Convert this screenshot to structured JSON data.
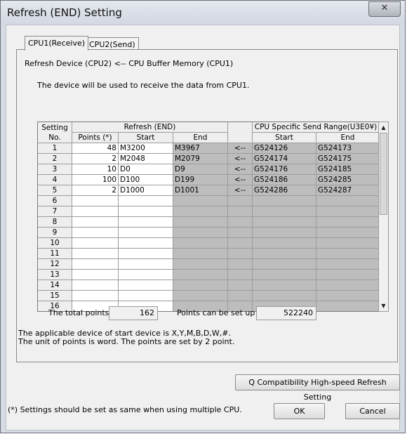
{
  "window": {
    "title": "Refresh (END) Setting",
    "close_glyph": "✕"
  },
  "tabs": [
    {
      "label": "CPU1(Receive)"
    },
    {
      "label": "CPU2(Send)"
    }
  ],
  "header": {
    "refresh_device": "Refresh Device (CPU2) <-- CPU Buffer Memory (CPU1)",
    "description": "The device will be used to receive the data from CPU1."
  },
  "table": {
    "col_setting_line1": "Setting",
    "col_setting_line2": "No.",
    "group_refresh": "Refresh (END)",
    "group_cpu": "CPU Specific Send Range(U3E0¥)",
    "col_points": "Points (*)",
    "col_start": "Start",
    "col_end": "End",
    "col_cpu_start": "Start",
    "col_cpu_end": "End",
    "rows": [
      {
        "no": "1",
        "points": "48",
        "start": "M3200",
        "end": "M3967",
        "arrow": "<--",
        "cpu_start": "G524126",
        "cpu_end": "G524173"
      },
      {
        "no": "2",
        "points": "2",
        "start": "M2048",
        "end": "M2079",
        "arrow": "<--",
        "cpu_start": "G524174",
        "cpu_end": "G524175"
      },
      {
        "no": "3",
        "points": "10",
        "start": "D0",
        "end": "D9",
        "arrow": "<--",
        "cpu_start": "G524176",
        "cpu_end": "G524185"
      },
      {
        "no": "4",
        "points": "100",
        "start": "D100",
        "end": "D199",
        "arrow": "<--",
        "cpu_start": "G524186",
        "cpu_end": "G524285"
      },
      {
        "no": "5",
        "points": "2",
        "start": "D1000",
        "end": "D1001",
        "arrow": "<--",
        "cpu_start": "G524286",
        "cpu_end": "G524287"
      },
      {
        "no": "6",
        "points": "",
        "start": "",
        "end": "",
        "arrow": "",
        "cpu_start": "",
        "cpu_end": ""
      },
      {
        "no": "7",
        "points": "",
        "start": "",
        "end": "",
        "arrow": "",
        "cpu_start": "",
        "cpu_end": ""
      },
      {
        "no": "8",
        "points": "",
        "start": "",
        "end": "",
        "arrow": "",
        "cpu_start": "",
        "cpu_end": ""
      },
      {
        "no": "9",
        "points": "",
        "start": "",
        "end": "",
        "arrow": "",
        "cpu_start": "",
        "cpu_end": ""
      },
      {
        "no": "10",
        "points": "",
        "start": "",
        "end": "",
        "arrow": "",
        "cpu_start": "",
        "cpu_end": ""
      },
      {
        "no": "11",
        "points": "",
        "start": "",
        "end": "",
        "arrow": "",
        "cpu_start": "",
        "cpu_end": ""
      },
      {
        "no": "12",
        "points": "",
        "start": "",
        "end": "",
        "arrow": "",
        "cpu_start": "",
        "cpu_end": ""
      },
      {
        "no": "13",
        "points": "",
        "start": "",
        "end": "",
        "arrow": "",
        "cpu_start": "",
        "cpu_end": ""
      },
      {
        "no": "14",
        "points": "",
        "start": "",
        "end": "",
        "arrow": "",
        "cpu_start": "",
        "cpu_end": ""
      },
      {
        "no": "15",
        "points": "",
        "start": "",
        "end": "",
        "arrow": "",
        "cpu_start": "",
        "cpu_end": ""
      },
      {
        "no": "16",
        "points": "",
        "start": "",
        "end": "",
        "arrow": "",
        "cpu_start": "",
        "cpu_end": ""
      }
    ]
  },
  "scrollbar": {
    "up_icon": "▲",
    "down_icon": "▼"
  },
  "totals": {
    "total_label": "The total points",
    "total_value": "162",
    "can_set_label": "Points can be set up",
    "can_set_value": "522240"
  },
  "notes": {
    "line1": "The applicable device of start device is X,Y,M,B,D,W,#.",
    "line2": "The unit of points is word. The points are set by 2 point."
  },
  "buttons": {
    "q_compat": "Q Compatibility High-speed Refresh Setting",
    "ok": "OK",
    "cancel": "Cancel"
  },
  "footer_note": "(*) Settings should be set as same when using multiple CPU.",
  "colors": {
    "dialog_bg": "#f0f0f0",
    "readonly_cell": "#bdbdbd",
    "titlebar": "#d6dbe4"
  }
}
